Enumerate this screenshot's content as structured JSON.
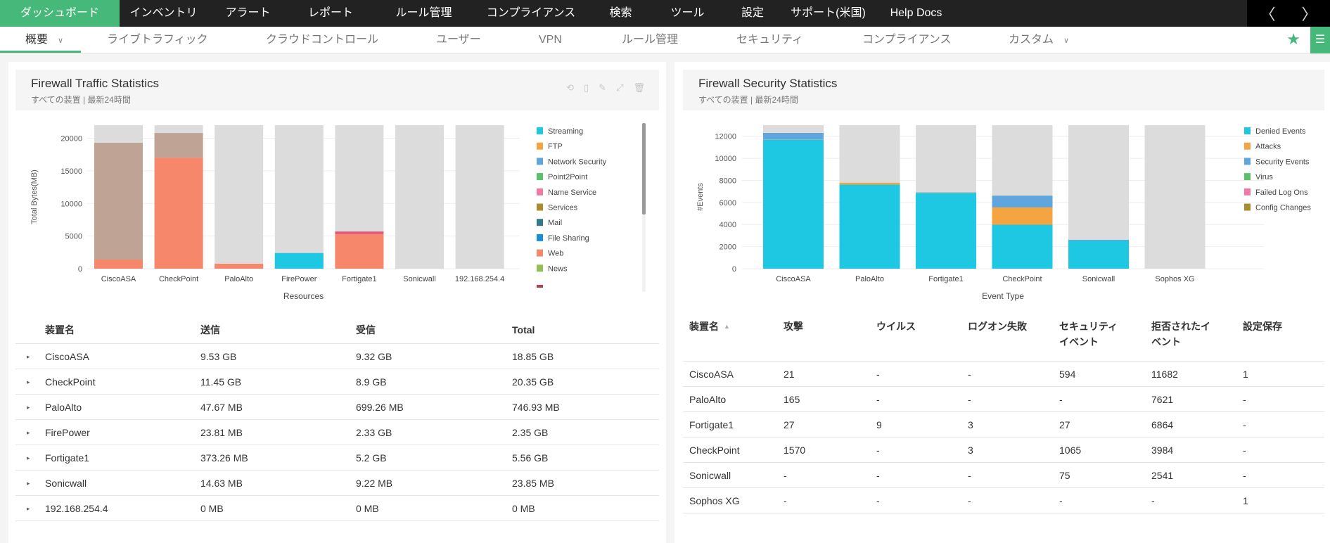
{
  "topnav": {
    "items": [
      "ダッシュボード",
      "インベントリ",
      "アラート",
      "レポート",
      "ルール管理",
      "コンプライアンス",
      "検索",
      "ツール",
      "設定",
      "サポート(米国)",
      "Help Docs"
    ],
    "prev": "〈",
    "next": "〉"
  },
  "subnav": {
    "items": [
      "概要",
      "ライブトラフィック",
      "クラウドコントロール",
      "ユーザー",
      "VPN",
      "ルール管理",
      "セキュリティ",
      "コンプライアンス",
      "カスタム"
    ],
    "chevron": "∨",
    "star": "★",
    "menu": "☰"
  },
  "traffic": {
    "title": "Firewall Traffic Statistics",
    "subtitle": "すべての装置 | 最新24時間",
    "table": {
      "headers": [
        "装置名",
        "送信",
        "受信",
        "Total"
      ],
      "rows": [
        [
          "CiscoASA",
          "9.53 GB",
          "9.32 GB",
          "18.85 GB"
        ],
        [
          "CheckPoint",
          "11.45 GB",
          "8.9 GB",
          "20.35 GB"
        ],
        [
          "PaloAlto",
          "47.67 MB",
          "699.26 MB",
          "746.93 MB"
        ],
        [
          "FirePower",
          "23.81 MB",
          "2.33 GB",
          "2.35 GB"
        ],
        [
          "Fortigate1",
          "373.26 MB",
          "5.2 GB",
          "5.56 GB"
        ],
        [
          "Sonicwall",
          "14.63 MB",
          "9.22 MB",
          "23.85 MB"
        ],
        [
          "192.168.254.4",
          "0 MB",
          "0 MB",
          "0 MB"
        ]
      ]
    }
  },
  "security": {
    "title": "Firewall Security Statistics",
    "subtitle": "すべての装置 | 最新24時間",
    "table": {
      "headers": [
        "装置名",
        "攻撃",
        "ウイルス",
        "ログオン失敗",
        "セキュリティ\nイベント",
        "拒否されたイ\nベント",
        "設定保存"
      ],
      "rows": [
        [
          "CiscoASA",
          "21",
          "-",
          "-",
          "594",
          "11682",
          "1"
        ],
        [
          "PaloAlto",
          "165",
          "-",
          "-",
          "-",
          "7621",
          "-"
        ],
        [
          "Fortigate1",
          "27",
          "9",
          "3",
          "27",
          "6864",
          "-"
        ],
        [
          "CheckPoint",
          "1570",
          "-",
          "3",
          "1065",
          "3984",
          "-"
        ],
        [
          "Sonicwall",
          "-",
          "-",
          "-",
          "75",
          "2541",
          "-"
        ],
        [
          "Sophos XG",
          "-",
          "-",
          "-",
          "-",
          "-",
          "1"
        ]
      ]
    }
  },
  "chart_data": [
    {
      "type": "bar",
      "stacked": true,
      "xlabel": "Resources",
      "ylabel": "Total Bytes(MB)",
      "ylim": [
        0,
        22000
      ],
      "yticks": [
        0,
        5000,
        10000,
        15000,
        20000
      ],
      "categories": [
        "CiscoASA",
        "CheckPoint",
        "PaloAlto",
        "FirePower",
        "Fortigate1",
        "Sonicwall",
        "192.168.254.4"
      ],
      "legend": [
        {
          "name": "Streaming",
          "color": "#1ec8e3"
        },
        {
          "name": "FTP",
          "color": "#f5a442"
        },
        {
          "name": "Network Security",
          "color": "#5ea6dc"
        },
        {
          "name": "Point2Point",
          "color": "#5cbf6a"
        },
        {
          "name": "Name Service",
          "color": "#ef7aa8"
        },
        {
          "name": "Services",
          "color": "#a88c2e"
        },
        {
          "name": "Mail",
          "color": "#2f7a8c"
        },
        {
          "name": "File Sharing",
          "color": "#1a8ed8"
        },
        {
          "name": "Web",
          "color": "#f7876b"
        },
        {
          "name": "News",
          "color": "#93bf5a"
        }
      ],
      "series": [
        {
          "name": "Streaming",
          "color": "#1ec8e3",
          "values": [
            0,
            0,
            0,
            2400,
            0,
            0,
            0
          ]
        },
        {
          "name": "Web",
          "color": "#f7876b",
          "values": [
            1400,
            17000,
            750,
            0,
            5300,
            0,
            0
          ]
        },
        {
          "name": "Name Service",
          "color": "#e5577a",
          "values": [
            0,
            0,
            0,
            0,
            400,
            0,
            0
          ]
        },
        {
          "name": "",
          "color": "#bfa395",
          "values": [
            17900,
            3800,
            0,
            0,
            0,
            0,
            0
          ]
        }
      ]
    },
    {
      "type": "bar",
      "stacked": true,
      "xlabel": "Event Type",
      "ylabel": "#Events",
      "ylim": [
        0,
        13000
      ],
      "yticks": [
        0,
        2000,
        4000,
        6000,
        8000,
        10000,
        12000
      ],
      "categories": [
        "CiscoASA",
        "PaloAlto",
        "Fortigate1",
        "CheckPoint",
        "Sonicwall",
        "Sophos XG"
      ],
      "legend": [
        {
          "name": "Denied Events",
          "color": "#1ec8e3"
        },
        {
          "name": "Attacks",
          "color": "#f5a442"
        },
        {
          "name": "Security Events",
          "color": "#5ea6dc"
        },
        {
          "name": "Virus",
          "color": "#5cbf6a"
        },
        {
          "name": "Failed Log Ons",
          "color": "#ef7aa8"
        },
        {
          "name": "Config Changes",
          "color": "#a88c2e"
        }
      ],
      "series": [
        {
          "name": "Denied Events",
          "color": "#1ec8e3",
          "values": [
            11682,
            7621,
            6864,
            3984,
            2541,
            0
          ]
        },
        {
          "name": "Attacks",
          "color": "#f5a442",
          "values": [
            21,
            165,
            27,
            1570,
            0,
            0
          ]
        },
        {
          "name": "Security Events",
          "color": "#5ea6dc",
          "values": [
            594,
            0,
            27,
            1065,
            75,
            0
          ]
        }
      ]
    }
  ]
}
